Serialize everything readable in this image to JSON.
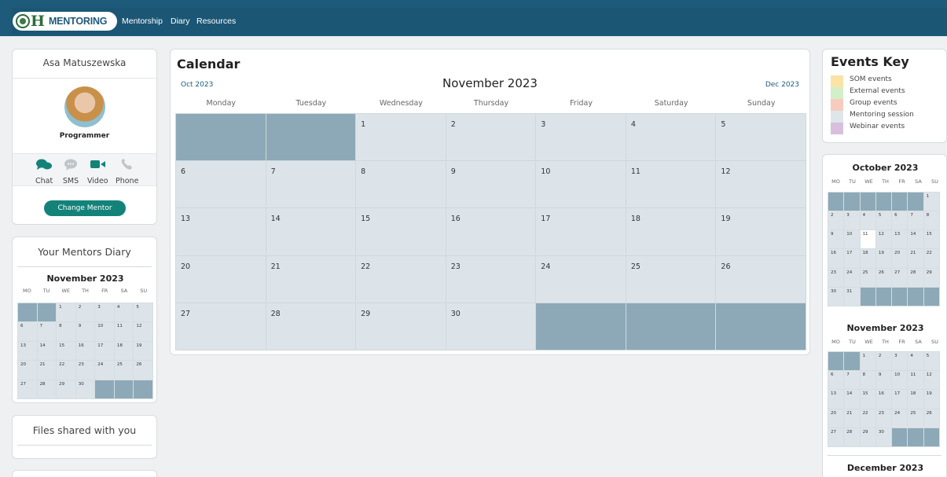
{
  "nav": {
    "brand": "MENTORING",
    "links": [
      "Mentorship",
      "Diary",
      "Resources"
    ]
  },
  "mentor": {
    "name": "Asa Matuszewska",
    "role": "Programmer",
    "contacts": [
      "Chat",
      "SMS",
      "Video",
      "Phone"
    ],
    "change_label": "Change Mentor"
  },
  "diary": {
    "title": "Your Mentors Diary",
    "month": "November 2023"
  },
  "files": {
    "title": "Files shared with you"
  },
  "calendar": {
    "title": "Calendar",
    "month": "November 2023",
    "prev": "Oct 2023",
    "next": "Dec 2023",
    "weekdays": [
      "Monday",
      "Tuesday",
      "Wednesday",
      "Thursday",
      "Friday",
      "Saturday",
      "Sunday"
    ],
    "cells": [
      "",
      "",
      "1",
      "2",
      "3",
      "4",
      "5",
      "6",
      "7",
      "8",
      "9",
      "10",
      "11",
      "12",
      "13",
      "14",
      "15",
      "16",
      "17",
      "18",
      "19",
      "20",
      "21",
      "22",
      "23",
      "24",
      "25",
      "26",
      "27",
      "28",
      "29",
      "30",
      "",
      "",
      ""
    ]
  },
  "mini_weekdays": [
    "MO",
    "TU",
    "WE",
    "TH",
    "FR",
    "SA",
    "SU"
  ],
  "events_key": {
    "title": "Events Key",
    "items": [
      {
        "label": "SOM events",
        "color": "#fbe3a6"
      },
      {
        "label": "External events",
        "color": "#d2efc9"
      },
      {
        "label": "Group events",
        "color": "#f8cbbf"
      },
      {
        "label": "Mentoring session",
        "color": "#dfe6ea"
      },
      {
        "label": "Webinar events",
        "color": "#d8bfdc"
      }
    ]
  },
  "side_calendars": [
    {
      "month": "October 2023",
      "cells": [
        "",
        "",
        "",
        "",
        "",
        "",
        "1",
        "2",
        "3",
        "4",
        "5",
        "6",
        "7",
        "8",
        "9",
        "10",
        "11",
        "12",
        "13",
        "14",
        "15",
        "16",
        "17",
        "18",
        "19",
        "20",
        "21",
        "22",
        "23",
        "24",
        "25",
        "26",
        "27",
        "28",
        "29",
        "30",
        "31",
        "",
        "",
        "",
        "",
        ""
      ],
      "today": "11"
    },
    {
      "month": "November 2023",
      "cells": [
        "",
        "",
        "1",
        "2",
        "3",
        "4",
        "5",
        "6",
        "7",
        "8",
        "9",
        "10",
        "11",
        "12",
        "13",
        "14",
        "15",
        "16",
        "17",
        "18",
        "19",
        "20",
        "21",
        "22",
        "23",
        "24",
        "25",
        "26",
        "27",
        "28",
        "29",
        "30",
        "",
        "",
        ""
      ]
    },
    {
      "month": "December 2023"
    }
  ]
}
